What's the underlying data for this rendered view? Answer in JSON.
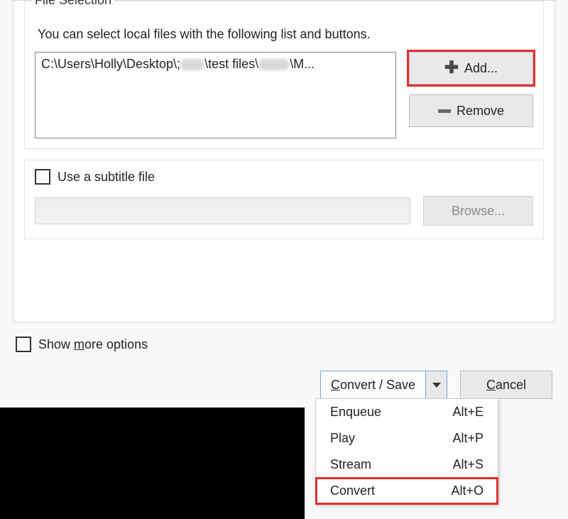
{
  "fileSelection": {
    "title": "File Selection",
    "description": "You can select local files with the following list and buttons.",
    "listItem": "C:\\Users\\Holly\\Desktop\\; … \\test files\\ … \\M…",
    "addLabel": "Add...",
    "removeLabel": "Remove"
  },
  "subtitle": {
    "checkboxLabel": "Use a subtitle file",
    "browseLabel": "Browse..."
  },
  "options": {
    "prefix": "Show ",
    "underlined": "m",
    "suffix": "ore options"
  },
  "buttons": {
    "convertSave_C": "C",
    "convertSave_rest": "onvert / Save",
    "cancel_C": "C",
    "cancel_rest": "ancel"
  },
  "menu": {
    "items": [
      {
        "label": "Enqueue",
        "shortcut": "Alt+E"
      },
      {
        "label": "Play",
        "shortcut": "Alt+P"
      },
      {
        "label": "Stream",
        "shortcut": "Alt+S"
      },
      {
        "label": "Convert",
        "shortcut": "Alt+O"
      }
    ]
  }
}
